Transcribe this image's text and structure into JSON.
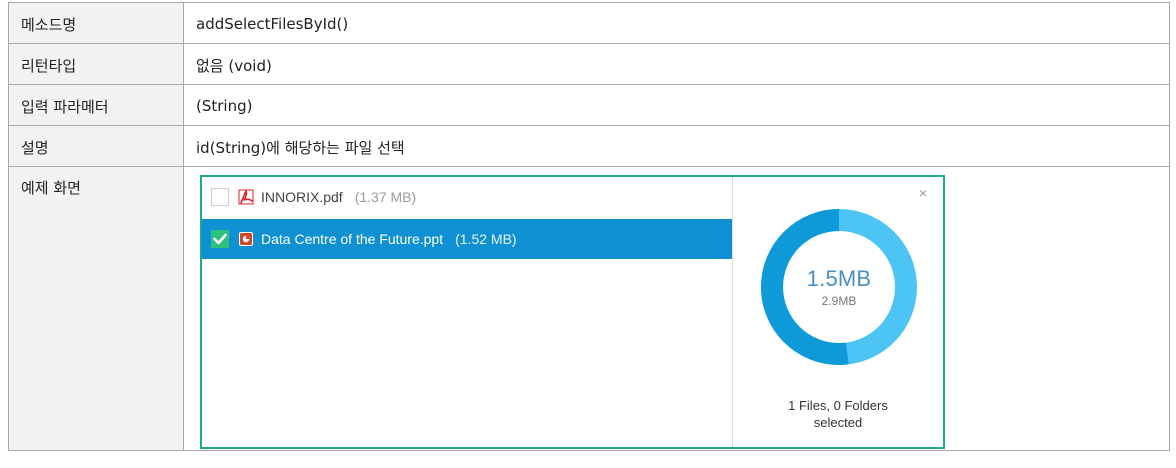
{
  "rows": [
    {
      "label": "메소드명",
      "value": "addSelectFilesById()"
    },
    {
      "label": "리턴타입",
      "value": "없음 (void)"
    },
    {
      "label": "입력 파라메터",
      "value": "(String)"
    },
    {
      "label": "설명",
      "value": "id(String)에 해당하는 파일 선택"
    }
  ],
  "example_label": "예제 화면",
  "widget": {
    "files": [
      {
        "name": "INNORIX.pdf",
        "size": "(1.37 MB)",
        "checked": false,
        "icon": "pdf-icon"
      },
      {
        "name": "Data Centre of the Future.ppt",
        "size": "(1.52 MB)",
        "checked": true,
        "icon": "ppt-icon"
      }
    ],
    "close_glyph": "×",
    "selected_size": "1.5MB",
    "total_size": "2.9MB",
    "summary_line1": "1 Files, 0 Folders",
    "summary_line2": "selected",
    "selected_fraction": 0.52,
    "colors": {
      "selected": "#0e9ad9",
      "remaining": "#4cc4f4",
      "border": "#1fa88d",
      "highlight": "#0e90d2",
      "check": "#2ec27e"
    }
  }
}
